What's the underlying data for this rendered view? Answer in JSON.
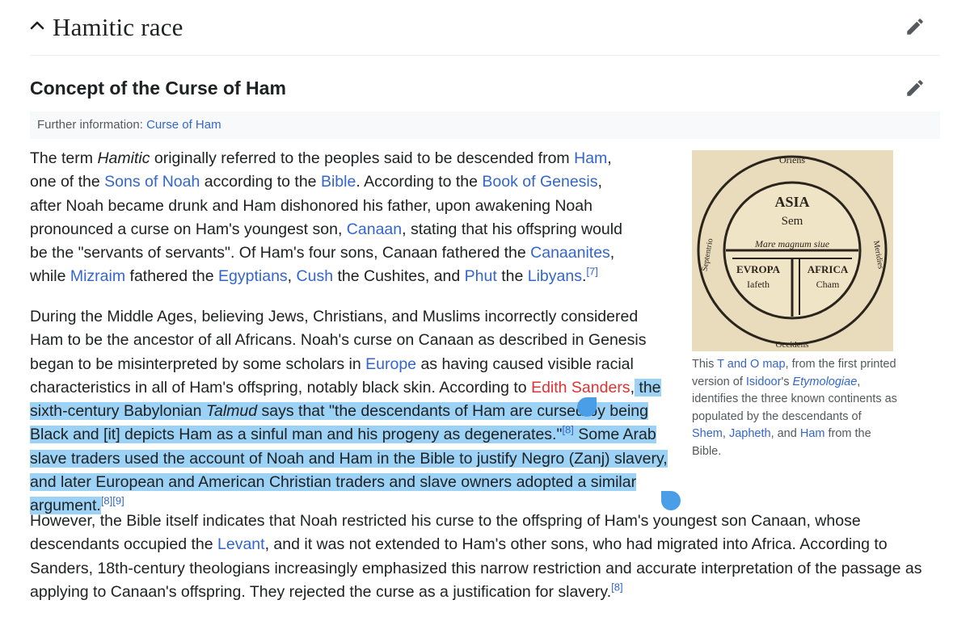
{
  "section": {
    "title": "Hamitic race"
  },
  "subsection": {
    "title": "Concept of the Curse of Ham"
  },
  "hatnote": {
    "prefix": "Further information: ",
    "link": "Curse of Ham"
  },
  "p1": {
    "s1": "The term ",
    "hamitic": "Hamitic",
    "s2": " originally referred to the peoples said to be descended from ",
    "ham": "Ham",
    "s3": ", one of the ",
    "sons_of_noah": "Sons of Noah",
    "s4": " according to the ",
    "bible": "Bible",
    "s5": ". According to the ",
    "book_of_genesis": "Book of Genesis",
    "s6": ", after Noah became drunk and Ham dishonored his father, upon awakening Noah pronounced a curse on Ham's youngest son, ",
    "canaan": "Canaan",
    "s7": ", stating that his offspring would be the \"servants of servants\". Of Ham's four sons, Canaan fathered the ",
    "canaanites": "Canaanites",
    "s8": ", while ",
    "mizraim": "Mizraim",
    "s9": " fathered the ",
    "egyptians": "Egyptians",
    "s10": ", ",
    "cush": "Cush",
    "s11": " the Cushites, and ",
    "phut": "Phut",
    "s12": " the ",
    "libyans": "Libyans",
    "s13": ".",
    "ref7": "[7]"
  },
  "p2": {
    "s1": "During the Middle Ages, believing Jews, Christians, and Muslims incorrectly considered Ham to be the ancestor of all Africans. Noah's curse on Canaan as described in Genesis began to be misinterpreted by some scholars in ",
    "europe": "Europe",
    "s2": " as having caused visible racial characteristics in all of Ham's offspring, notably black skin. According to ",
    "edith_sanders": "Edith Sanders",
    "s3": ",",
    "sel1": " the sixth-century Babylonian ",
    "talmud": "Talmud",
    "sel2": " says that \"the descendants of Ham are cursed by being Black and [it] depicts Ham as a sinful man and his progeny as degenerates.\"",
    "ref8a": "[8]",
    "sel3": " Some Arab slave traders used the account of Noah and Ham in the Bible to justify Negro (Zanj) slavery, and later European and American Christian traders and slave owners adopted a similar argument.",
    "ref8b": "[8]",
    "ref9": "[9]"
  },
  "p3": {
    "s1": "However, the Bible itself indicates that Noah restricted his curse to the offspring of Ham's youngest son Canaan, whose descendants occupied the ",
    "levant": "Levant",
    "s2": ", and it was not extended to Ham's other sons, who had migrated into Africa. According to Sanders, 18th-century theologians increasingly emphasized this narrow restriction and accurate interpretation of the passage as applying to Canaan's offspring. They rejected the curse as a justification for slavery.",
    "ref8": "[8]"
  },
  "figure": {
    "map_labels": {
      "oriens": "Oriens",
      "occidens": "Occidens",
      "asia": "ASIA",
      "sem": "Sem",
      "mare": "Mare magnum siue",
      "europa": "EVROPA",
      "iafeth": "Iafeth",
      "africa": "AFRICA",
      "cham": "Cham",
      "septentrio": "Septentrio",
      "meridies": "Meridies"
    },
    "caption": {
      "s1": "This ",
      "t_and_o_map": "T and O map",
      "s2": ", from the first printed version of ",
      "isidoor": "Isidoor",
      "s3": "'s ",
      "etymologiae": "Etymologiae",
      "s4": ", identifies the three known continents as populated by the descendants of ",
      "shem": "Shem",
      "s5": ", ",
      "japheth": "Japheth",
      "s6": ", and ",
      "ham": "Ham",
      "s7": " from the Bible."
    }
  },
  "colors": {
    "link": "#3366cc",
    "redlink": "#dd3333",
    "selection": "#9bd2f5",
    "handle": "#4a9ee8"
  },
  "icons": [
    "chevron-up-icon",
    "pencil-icon"
  ]
}
